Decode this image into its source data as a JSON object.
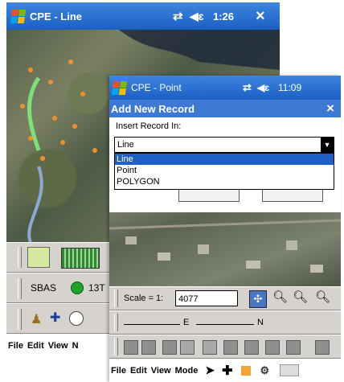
{
  "back_window": {
    "title": "CPE - Line",
    "time": "1:26",
    "close": "×",
    "status_label": "SBAS",
    "status_value": "13T",
    "menu": [
      "File",
      "Edit",
      "View",
      "N"
    ]
  },
  "front_window": {
    "title": "CPE - Point",
    "time": "11:09",
    "dialog_title": "Add New Record",
    "dialog_close": "×",
    "insert_label": "Insert Record In:",
    "selected_value": "Line",
    "options": [
      "Line",
      "Point",
      "POLYGON"
    ],
    "scale_label": "Scale = 1:",
    "scale_value": "4077",
    "coord_e": "E",
    "coord_n": "N",
    "menu": [
      "File",
      "Edit",
      "View",
      "Mode"
    ]
  },
  "colors": {
    "titlebar": "#1c5fc4",
    "selection": "#1f5fc8",
    "status_ok": "#1fa52a"
  }
}
